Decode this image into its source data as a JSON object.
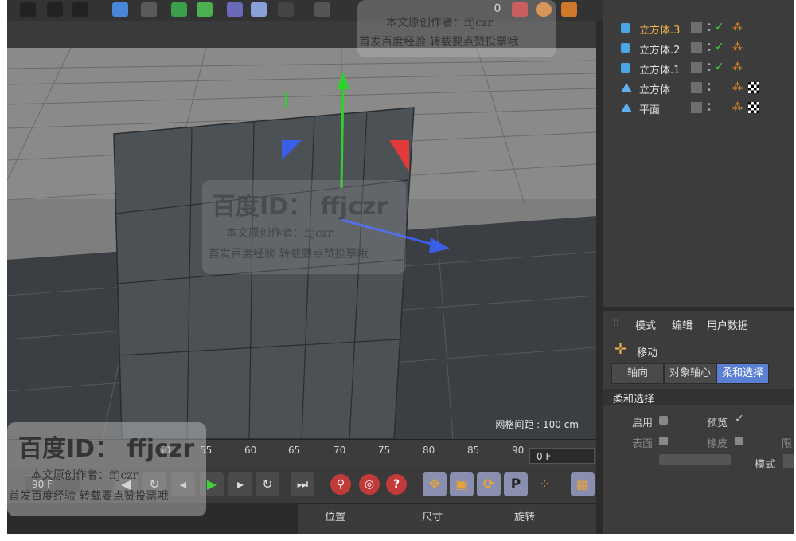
{
  "objects": [
    {
      "name": "立方体.3",
      "type": "cube",
      "selected": true,
      "highlight_color": "#f3b74a",
      "checkered": false
    },
    {
      "name": "立方体.2",
      "type": "cube",
      "selected": false,
      "checkered": false
    },
    {
      "name": "立方体.1",
      "type": "cube",
      "selected": false,
      "checkered": false
    },
    {
      "name": "立方体",
      "type": "null",
      "selected": false,
      "checkered": true
    },
    {
      "name": "平面",
      "type": "null",
      "selected": false,
      "checkered": true
    }
  ],
  "viewport": {
    "grid_spacing": "网格间距 : 100 cm"
  },
  "timeline": {
    "ticks": [
      "50",
      "55",
      "60",
      "65",
      "70",
      "75",
      "80",
      "85",
      "90"
    ],
    "current_frame": "0 F",
    "end_frame": "90 F"
  },
  "attributes": {
    "menu": [
      "模式",
      "编辑",
      "用户数据"
    ],
    "tool_title": "移动",
    "tabs": [
      "轴向",
      "对象轴心",
      "柔和选择"
    ],
    "active_tab": "柔和选择",
    "section": "柔和选择",
    "labels": {
      "enable": "启用",
      "preview": "预览",
      "surface": "表面",
      "rubber": "橡皮",
      "mode": "模式",
      "limit": "限"
    }
  },
  "coords": {
    "headers": [
      "位置",
      "尺寸",
      "旋转"
    ]
  },
  "watermark": {
    "id_text": "百度ID： ffjczr",
    "line1": "本文原创作者：ffjczr",
    "line2": "首发百度经验 转载要点赞投票哦"
  },
  "colors": {
    "accent_yellow": "#f3b74a",
    "tab_active": "#5b7fd3",
    "check_green": "#3fd13f",
    "axis_red": "#e03a3a",
    "axis_green": "#2fd12f",
    "axis_blue": "#3a5ee8"
  }
}
